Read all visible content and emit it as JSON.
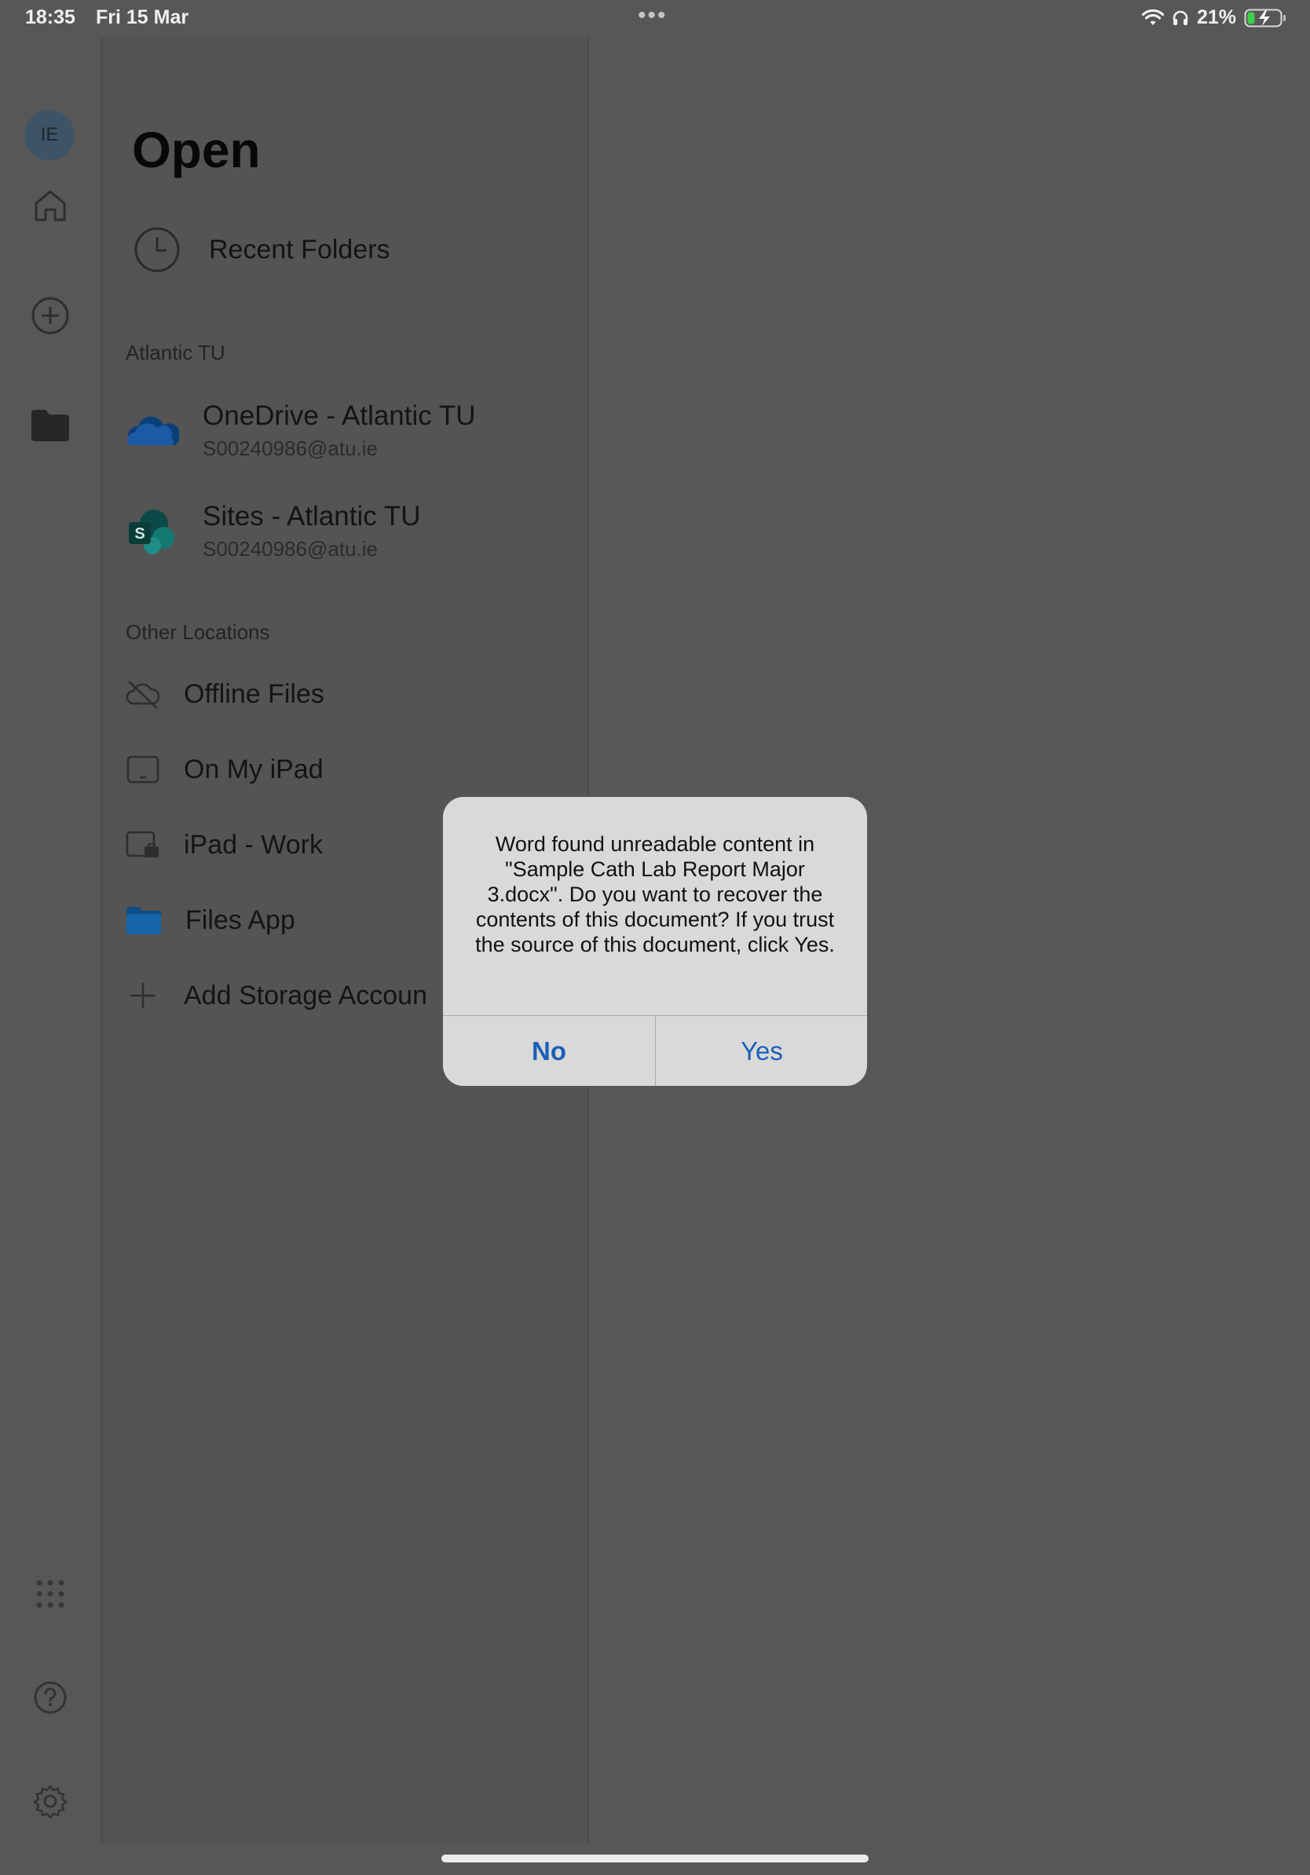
{
  "status_bar": {
    "time": "18:35",
    "date": "Fri 15 Mar",
    "battery": "21%",
    "icons": [
      "wifi-icon",
      "headphones-icon",
      "battery-charging-icon"
    ]
  },
  "rail": {
    "avatar_initials": "IE",
    "items": [
      "home-icon",
      "create-new-icon",
      "open-folder-icon"
    ],
    "bottom_items": [
      "app-launcher-icon",
      "help-icon",
      "settings-icon"
    ]
  },
  "panel": {
    "title": "Open",
    "recent_label": "Recent Folders",
    "section_org": "Atlantic TU",
    "org_locations": [
      {
        "title": "OneDrive - Atlantic TU",
        "subtitle": "S00240986@atu.ie",
        "icon": "onedrive-icon"
      },
      {
        "title": "Sites - Atlantic TU",
        "subtitle": "S00240986@atu.ie",
        "icon": "sharepoint-icon"
      }
    ],
    "section_other": "Other Locations",
    "other_locations": [
      {
        "label": "Offline Files",
        "icon": "offline-cloud-icon"
      },
      {
        "label": "On My iPad",
        "icon": "ipad-icon"
      },
      {
        "label": "iPad - Work",
        "icon": "ipad-work-icon"
      },
      {
        "label": "Files App",
        "icon": "files-app-folder-icon"
      },
      {
        "label": "Add Storage Accoun",
        "icon": "plus-icon"
      }
    ]
  },
  "dialog": {
    "message": "Word found unreadable content in \"Sample Cath Lab Report Major 3.docx\". Do you want to recover the contents of this document? If you trust the source of this document, click Yes.",
    "no_label": "No",
    "yes_label": "Yes",
    "accent_color": "#1c5fb8"
  }
}
